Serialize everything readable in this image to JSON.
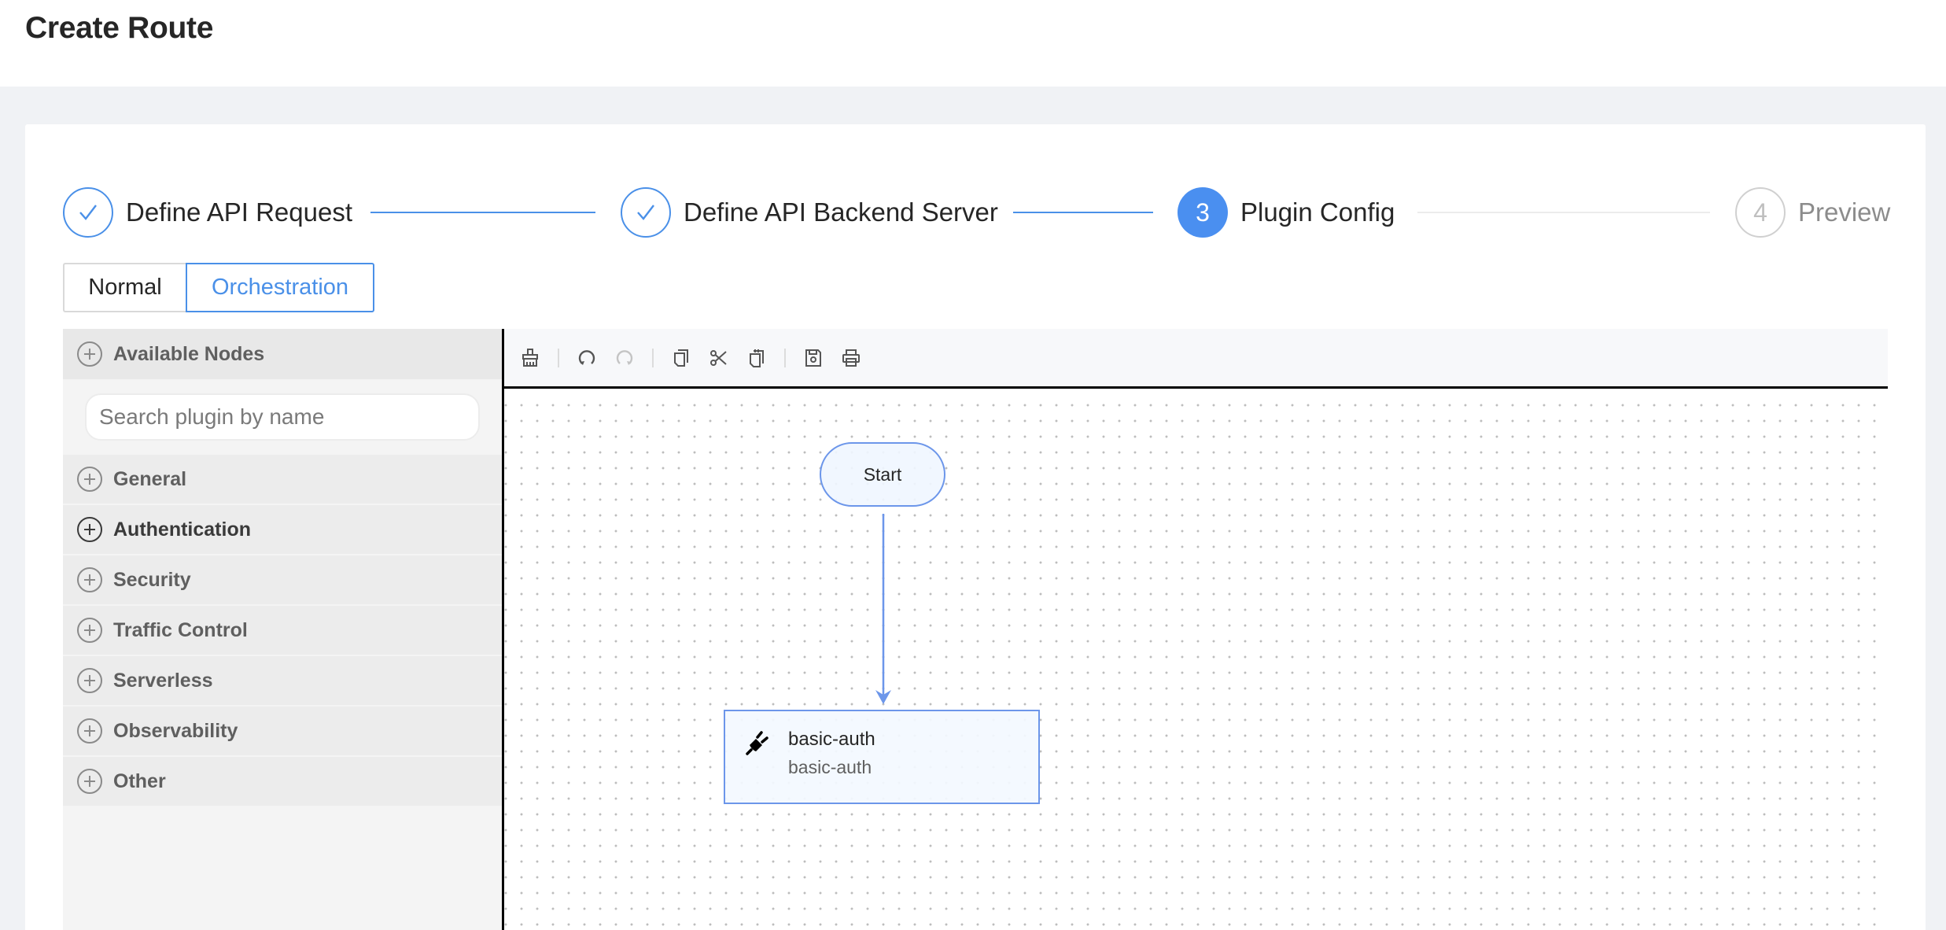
{
  "header": {
    "title": "Create Route"
  },
  "steps": [
    {
      "index": "1",
      "title": "Define API Request",
      "status": "done"
    },
    {
      "index": "2",
      "title": "Define API Backend Server",
      "status": "done"
    },
    {
      "index": "3",
      "title": "Plugin Config",
      "status": "active"
    },
    {
      "index": "4",
      "title": "Preview",
      "status": "wait"
    }
  ],
  "mode": {
    "options": [
      "Normal",
      "Orchestration"
    ],
    "selected": "Orchestration"
  },
  "sidebar": {
    "header": "Available Nodes",
    "search_placeholder": "Search plugin by name",
    "search_value": "",
    "categories": [
      {
        "label": "General"
      },
      {
        "label": "Authentication",
        "hovered": true
      },
      {
        "label": "Security"
      },
      {
        "label": "Traffic Control"
      },
      {
        "label": "Serverless"
      },
      {
        "label": "Observability"
      },
      {
        "label": "Other"
      }
    ]
  },
  "toolbar": {
    "buttons": [
      {
        "name": "clear",
        "icon": "broom-icon",
        "enabled": true
      },
      {
        "name": "undo",
        "icon": "undo-icon",
        "enabled": true
      },
      {
        "name": "redo",
        "icon": "redo-icon",
        "enabled": false
      },
      {
        "name": "copy",
        "icon": "copy-icon",
        "enabled": true
      },
      {
        "name": "cut",
        "icon": "scissors-icon",
        "enabled": true
      },
      {
        "name": "paste",
        "icon": "paste-icon",
        "enabled": true
      },
      {
        "name": "save",
        "icon": "save-icon",
        "enabled": true
      },
      {
        "name": "print",
        "icon": "printer-icon",
        "enabled": true
      }
    ]
  },
  "canvas": {
    "start_node": {
      "label": "Start"
    },
    "plugin_node": {
      "title": "basic-auth",
      "subtitle": "basic-auth",
      "icon": "plug-icon"
    },
    "edges": [
      {
        "from": "Start",
        "to": "basic-auth"
      }
    ]
  },
  "colors": {
    "primary": "#4a90e8",
    "edge": "#6c96ea",
    "sidebar_bg": "#f4f4f4",
    "page_bg": "#f0f2f5"
  }
}
